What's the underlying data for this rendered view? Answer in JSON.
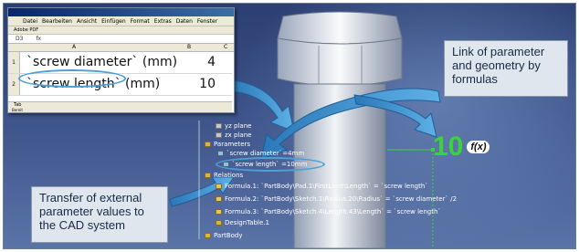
{
  "excel": {
    "menu_items": [
      "Datei",
      "Bearbeiten",
      "Ansicht",
      "Einfügen",
      "Format",
      "Extras",
      "Daten",
      "Fenster"
    ],
    "toolbar_text": "Adobe PDF",
    "name_box": "D3",
    "formula_symbol": "fx",
    "column_headers": [
      "A",
      "B",
      "C"
    ],
    "rows": [
      {
        "num": "1",
        "label": "`screw diameter` (mm)",
        "value": "4"
      },
      {
        "num": "2",
        "label": "`screw length` (mm)",
        "value": "10"
      }
    ],
    "sheet_tab": "Tab",
    "status": "Bereit"
  },
  "callouts": {
    "link_text": "Link of parameter and geometry by formulas",
    "transfer_text": "Transfer of external parameter values to the CAD system"
  },
  "tree": {
    "nodes": [
      {
        "label": "yz plane",
        "icon": "plane-icon"
      },
      {
        "label": "zx plane",
        "icon": "plane-icon"
      },
      {
        "label": "Parameters",
        "icon": "parameters-icon"
      },
      {
        "label": "`screw diameter`=4mm",
        "icon": "parameter-icon"
      },
      {
        "label": "`screw length` =10mm",
        "icon": "parameter-icon"
      },
      {
        "label": "Relations",
        "icon": "relations-icon"
      },
      {
        "label": "Formula.1: `PartBody\\Pad.1\\FirstLimit\\Length` = `screw length`",
        "icon": "formula-icon"
      },
      {
        "label": "Formula.2: `PartBody\\Sketch.1\\Radius.20\\Radius` = `screw diameter` /2",
        "icon": "formula-icon"
      },
      {
        "label": "Formula.3: `PartBody\\Sketch.4\\Length.43\\Length` = `screw length`",
        "icon": "formula-icon"
      },
      {
        "label": "DesignTable.1",
        "icon": "table-icon"
      },
      {
        "label": "PartBody",
        "icon": "body-icon"
      }
    ]
  },
  "fx_value": "10",
  "fx_symbol": "f(x)",
  "colors": {
    "background": "#3c5288",
    "oval": "#4aa0d8",
    "arrow": "#3f8fc8",
    "fx_green": "#3cd23c",
    "callout_bg": "#dfe6ee"
  }
}
